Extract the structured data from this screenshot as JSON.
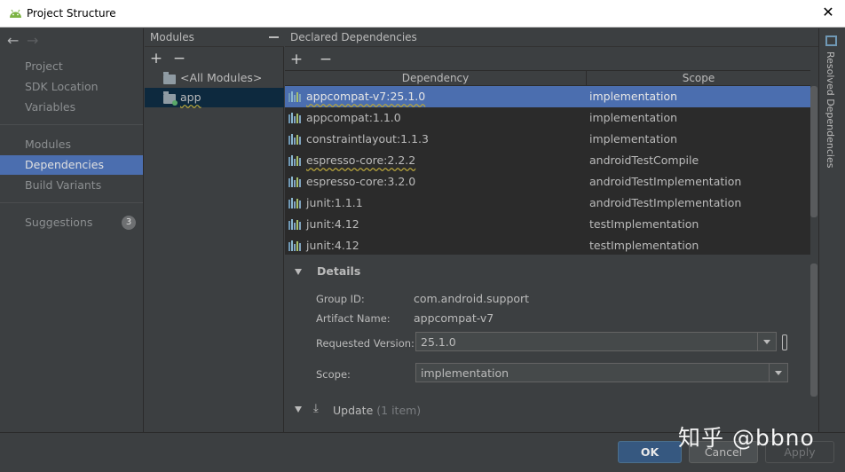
{
  "window": {
    "title": "Project Structure",
    "close_glyph": "✕"
  },
  "nav": {
    "back": "←",
    "forward": "→",
    "groups": [
      [
        "Project",
        "SDK Location",
        "Variables"
      ],
      [
        "Modules",
        "Dependencies",
        "Build Variants"
      ]
    ],
    "items": {
      "project": "Project",
      "sdk_location": "SDK Location",
      "variables": "Variables",
      "modules": "Modules",
      "dependencies": "Dependencies",
      "build_variants": "Build Variants",
      "suggestions": "Suggestions"
    },
    "suggestions_count": "3",
    "active": "Dependencies"
  },
  "modules_panel": {
    "header": "Modules",
    "add": "+",
    "remove": "−",
    "items": {
      "all": "<All Modules>",
      "app": "app"
    },
    "selected": "app"
  },
  "deps_panel": {
    "header": "Declared Dependencies",
    "add": "+",
    "remove": "−",
    "columns": {
      "dependency": "Dependency",
      "scope": "Scope"
    },
    "rows": [
      {
        "name": "appcompat-v7:25.1.0",
        "scope": "implementation",
        "selected": true,
        "warning": true
      },
      {
        "name": "appcompat:1.1.0",
        "scope": "implementation",
        "selected": false,
        "warning": false
      },
      {
        "name": "constraintlayout:1.1.3",
        "scope": "implementation",
        "selected": false,
        "warning": false
      },
      {
        "name": "espresso-core:2.2.2",
        "scope": "androidTestCompile",
        "selected": false,
        "warning": true
      },
      {
        "name": "espresso-core:3.2.0",
        "scope": "androidTestImplementation",
        "selected": false,
        "warning": false
      },
      {
        "name": "junit:1.1.1",
        "scope": "androidTestImplementation",
        "selected": false,
        "warning": false
      },
      {
        "name": "junit:4.12",
        "scope": "testImplementation",
        "selected": false,
        "warning": false
      },
      {
        "name": "junit:4.12",
        "scope": "testImplementation",
        "selected": false,
        "warning": false
      }
    ]
  },
  "details": {
    "title": "Details",
    "group_id_label": "Group ID:",
    "group_id": "com.android.support",
    "artifact_label": "Artifact Name:",
    "artifact": "appcompat-v7",
    "requested_version_label": "Requested Version:",
    "requested_version": "25.1.0",
    "scope_label": "Scope:",
    "scope": "implementation",
    "update_label": "Update",
    "update_count": "(1 item)"
  },
  "right_strip": {
    "label": "Resolved Dependencies"
  },
  "buttons": {
    "ok": "OK",
    "cancel": "Cancel",
    "apply": "Apply"
  },
  "watermark": "知乎 @bbno",
  "colors": {
    "selection": "#4b6eaf",
    "background": "#3c3f41",
    "table_bg": "#2b2b2b",
    "ok_button": "#365880"
  }
}
